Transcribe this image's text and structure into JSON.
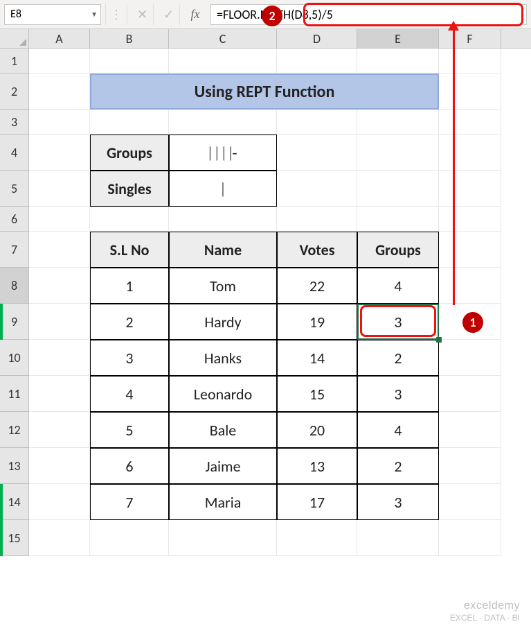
{
  "formula_bar": {
    "cell_ref": "E8",
    "cancel_icon": "✕",
    "enter_icon": "✓",
    "fx_label": "fx",
    "formula": "=FLOOR.MATH(D8,5)/5"
  },
  "columns": [
    "A",
    "B",
    "C",
    "D",
    "E",
    "F"
  ],
  "row_numbers": [
    "1",
    "2",
    "3",
    "4",
    "5",
    "6",
    "7",
    "8",
    "9",
    "10",
    "11",
    "12",
    "13",
    "14",
    "15"
  ],
  "title": "Using REPT Function",
  "labels": {
    "groups": "Groups",
    "singles": "Singles"
  },
  "tally": {
    "groups": "| | | |-",
    "singles": "|"
  },
  "table": {
    "headers": [
      "S.L No",
      "Name",
      "Votes",
      "Groups"
    ],
    "rows": [
      {
        "sl": "1",
        "name": "Tom",
        "votes": "22",
        "groups": "4"
      },
      {
        "sl": "2",
        "name": "Hardy",
        "votes": "19",
        "groups": "3"
      },
      {
        "sl": "3",
        "name": "Hanks",
        "votes": "14",
        "groups": "2"
      },
      {
        "sl": "4",
        "name": "Leonardo",
        "votes": "15",
        "groups": "3"
      },
      {
        "sl": "5",
        "name": "Bale",
        "votes": "20",
        "groups": "4"
      },
      {
        "sl": "6",
        "name": "Jaime",
        "votes": "13",
        "groups": "2"
      },
      {
        "sl": "7",
        "name": "Maria",
        "votes": "17",
        "groups": "3"
      }
    ]
  },
  "callouts": {
    "badge1": "1",
    "badge2": "2"
  },
  "watermark": {
    "main": "exceldemy",
    "sub": "EXCEL · DATA · BI"
  }
}
